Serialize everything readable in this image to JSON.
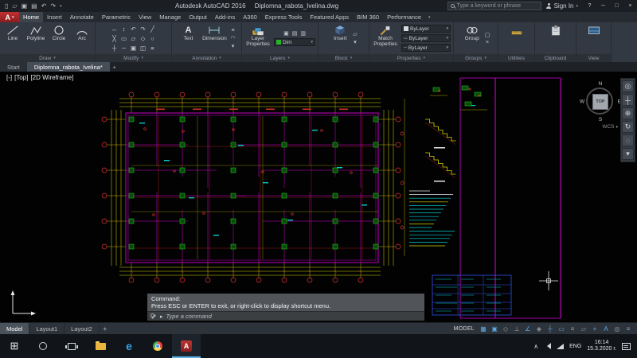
{
  "icons": {
    "app_logo": "A",
    "qat": [
      "▯",
      "▱",
      "▣",
      "▤",
      "↶",
      "↷"
    ],
    "caret": "▾",
    "help": "?",
    "win_min": "─",
    "win_max": "□",
    "win_close": "×",
    "start": "⊞",
    "tray_chevron": "∧",
    "prompt_arrow": "▸",
    "plus": "+",
    "text_tool": "A",
    "edge": "e",
    "navbar": [
      "◎",
      "┼",
      "⊕",
      "↻",
      "◌",
      "▾"
    ]
  },
  "title_bar": {
    "app_name": "Autodesk AutoCAD 2016",
    "doc_name": "Diplomna_rabota_Ivelina.dwg",
    "search_placeholder": "Type a keyword or phrase",
    "sign_in_label": "Sign In"
  },
  "ribbon": {
    "tabs": [
      "Home",
      "Insert",
      "Annotate",
      "Parametric",
      "View",
      "Manage",
      "Output",
      "Add-ins",
      "A360",
      "Express Tools",
      "Featured Apps",
      "BIM 360",
      "Performance"
    ],
    "active_tab": "Home",
    "panels": {
      "draw": {
        "label": "Draw",
        "tools": {
          "line": "Line",
          "polyline": "Polyline",
          "circle": "Circle",
          "arc": "Arc"
        }
      },
      "modify": {
        "label": "Modify",
        "tool_glyphs": [
          "↔",
          "↕",
          "↶",
          "↷",
          "╱",
          "╳",
          "▭",
          "▱",
          "◇",
          "○",
          "┼",
          "─",
          "▣",
          "◫",
          "≡"
        ]
      },
      "annotation": {
        "label": "Annotation",
        "text": "Text",
        "dimension": "Dimension",
        "tool_glyphs": [
          "≡",
          "◠",
          "▾"
        ]
      },
      "layers": {
        "label": "Layers",
        "layer_properties": "Layer Properties",
        "current_layer": "Dim",
        "tool_glyphs": [
          "▣",
          "▤",
          "▥"
        ]
      },
      "block": {
        "label": "Block",
        "insert": "Insert",
        "tool_glyphs": [
          "▱",
          "▾"
        ]
      },
      "properties": {
        "label": "Properties",
        "match": "Match Properties",
        "value": "ByLayer",
        "lineweight_glyph": "─",
        "linetype_glyph": "┄"
      },
      "groups": {
        "label": "Groups",
        "group": "Group",
        "tool_glyphs": [
          "▢",
          "×"
        ]
      },
      "utilities": {
        "label": "Utilities"
      },
      "clipboard": {
        "label": "Clipboard"
      },
      "view_panel": {
        "label": "View"
      }
    }
  },
  "file_tabs": {
    "start": "Start",
    "document": "Diplomna_rabota_Ivelina*"
  },
  "drawing": {
    "viewport_controls": [
      "[-]",
      "[Top]",
      "[2D Wireframe]"
    ],
    "viewcube": {
      "north": "N",
      "west": "W",
      "south": "S",
      "east": "E",
      "face": "TOP",
      "coord_system": "WCS"
    }
  },
  "command_window": {
    "history_line1": "Command:",
    "history_line2": "Press ESC or ENTER to exit, or right-click to display shortcut menu.",
    "prompt_placeholder": "Type a command"
  },
  "layout_tabs": {
    "model": "Model",
    "layout1": "Layout1",
    "layout2": "Layout2"
  },
  "status_bar": {
    "model_label": "MODEL",
    "active_color": "#5aa7e0",
    "icons": [
      {
        "name": "grid",
        "glyph": "▦",
        "on": true
      },
      {
        "name": "snap",
        "glyph": "▣",
        "on": true
      },
      {
        "name": "infer-constraints",
        "glyph": "◇",
        "on": false
      },
      {
        "name": "ortho",
        "glyph": "⊥",
        "on": false
      },
      {
        "name": "polar-tracking",
        "glyph": "∠",
        "on": true
      },
      {
        "name": "isodraft",
        "glyph": "◈",
        "on": false
      },
      {
        "name": "object-snap-tracking",
        "glyph": "┼",
        "on": true
      },
      {
        "name": "object-snap",
        "glyph": "▭",
        "on": true
      },
      {
        "name": "lineweight",
        "glyph": "≡",
        "on": false
      },
      {
        "name": "transparency",
        "glyph": "▱",
        "on": false
      },
      {
        "name": "dynamic-input",
        "glyph": "+",
        "on": true
      },
      {
        "name": "annotation-scale",
        "glyph": "A",
        "on": true
      },
      {
        "name": "workspace",
        "glyph": "◎",
        "on": false
      },
      {
        "name": "customize",
        "glyph": "≡",
        "on": false
      }
    ]
  },
  "taskbar": {
    "language": "ENG",
    "time": "16:14",
    "date": "15.3.2020 г."
  }
}
